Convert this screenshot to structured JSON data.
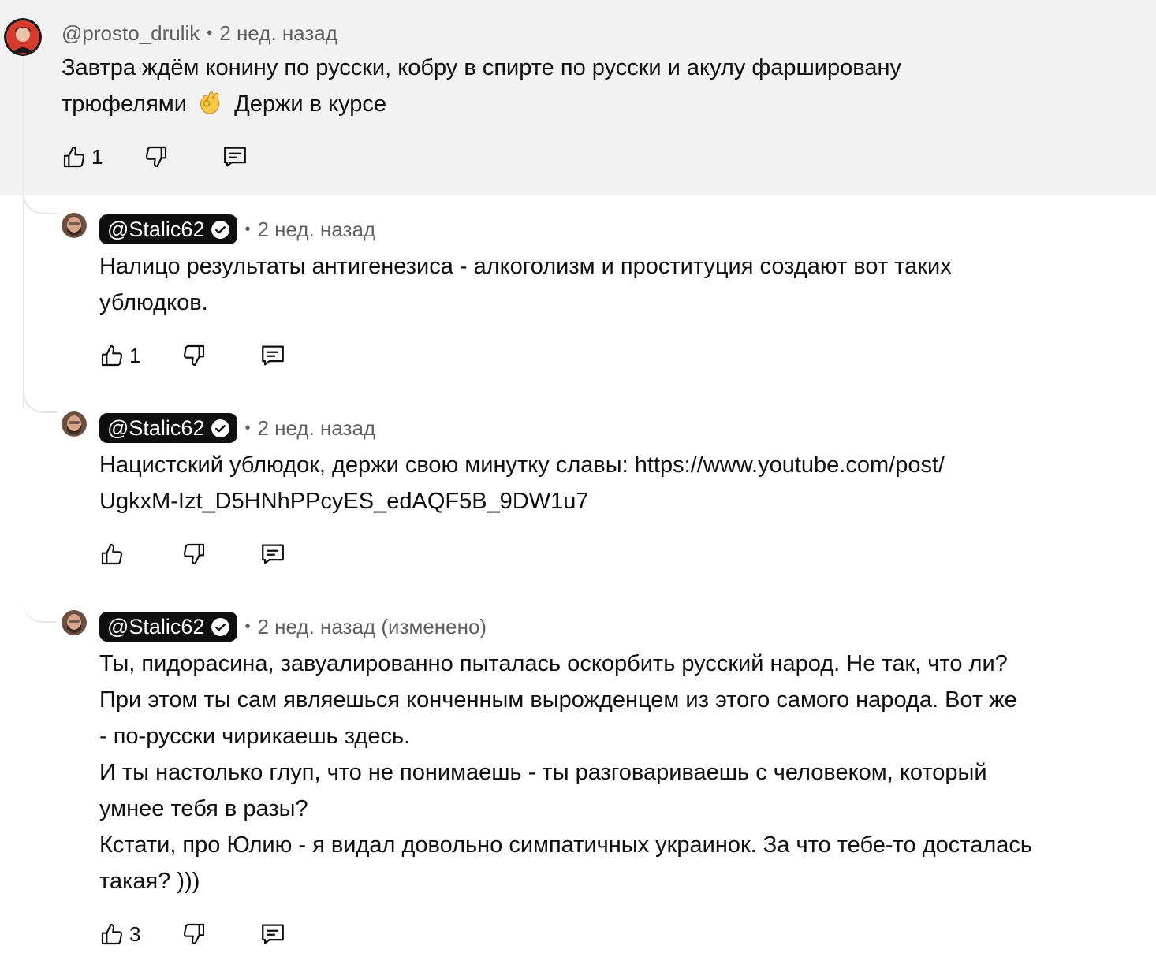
{
  "comments": [
    {
      "author": "@prosto_drulik",
      "time": "2 нед. назад",
      "text_lines": [
        "Завтра ждём конину по русски, кобру в спирте по русски и акулу фаршировану",
        "трюфелями"
      ],
      "text_after_emoji": "Держи в курсе",
      "likes": "1"
    },
    {
      "author": "@Stalic62",
      "time": "2 нед. назад",
      "text_lines": [
        "Налицо результаты антигенезиса - алкоголизм и проституция создают вот таких",
        "ублюдков."
      ],
      "likes": "1"
    },
    {
      "author": "@Stalic62",
      "time": "2 нед. назад",
      "text_lines": [
        "Нацистский ублюдок, держи свою минутку славы: https://www.youtube.com/post/",
        "UgkxM-Izt_D5HNhPPcyES_edAQF5B_9DW1u7"
      ],
      "likes": ""
    },
    {
      "author": "@Stalic62",
      "time": "2 нед. назад (изменено)",
      "text_lines": [
        "Ты, пидорасина, завуалированно пыталась оскорбить русский народ. Не так, что ли?",
        "При этом ты сам являешься конченным вырожденцем из этого самого народа. Вот же",
        "- по-русски чирикаешь здесь.",
        "И ты настолько глуп, что не понимаешь - ты разговариваешь с человеком, который",
        "умнее тебя в разы?",
        "Кстати, про Юлию - я видал довольно симпатичных украинок. За что тебе-то досталась",
        "такая? )))"
      ],
      "likes": "3"
    }
  ],
  "icons": {
    "like": "thumbs-up-icon",
    "dislike": "thumbs-down-icon",
    "reply": "reply-comment-icon",
    "verified": "verified-check-icon",
    "emoji": "ok-hand-emoji"
  },
  "colors": {
    "highlight_bg": "#f2f2f2",
    "meta_text": "#606060",
    "owner_chip": "#0f0f0f",
    "thread_line": "#e5e5e5"
  }
}
